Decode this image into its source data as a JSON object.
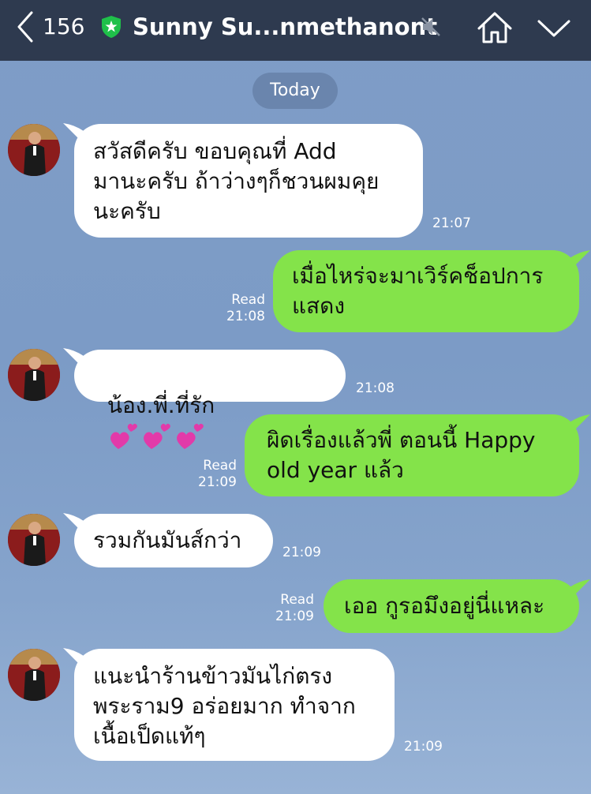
{
  "header": {
    "unread_count": "156",
    "title": "Sunny Su...nmethanont"
  },
  "date_label": "Today",
  "messages": [
    {
      "text": "สวัสดีครับ ขอบคุณที่ Add\nมานะครับ ถ้าว่างๆก็ชวนผมคุย\nนะครับ",
      "time": "21:07"
    },
    {
      "text": "เมื่อไหร่จะมาเวิร์คช็อปการ\nแสดง",
      "read": "Read",
      "time": "21:08"
    },
    {
      "text": "น้อง.พี่.ที่รัก",
      "time": "21:08"
    },
    {
      "text": "ผิดเรื่องแล้วพี่ ตอนนี้ Happy\nold year แล้ว",
      "read": "Read",
      "time": "21:09"
    },
    {
      "text": "รวมกันมันส์กว่า",
      "time": "21:09"
    },
    {
      "text": "เออ กูรอมึงอยู่นี่แหละ",
      "read": "Read",
      "time": "21:09"
    },
    {
      "text": "แนะนำร้านข้าวมันไก่ตรง\nพระราม9 อร่อยมาก ทำจาก\nเนื้อเป็ดแท้ๆ",
      "time": "21:09"
    }
  ],
  "colors": {
    "header_bg": "#2e3a4f",
    "incoming_bubble": "#ffffff",
    "outgoing_bubble": "#84e34a",
    "chat_bg": "#7f9dc7"
  },
  "icons": [
    "back-chevron-icon",
    "official-shield-icon",
    "mute-icon",
    "home-icon",
    "chevron-down-icon",
    "heart-emoji-icon"
  ]
}
